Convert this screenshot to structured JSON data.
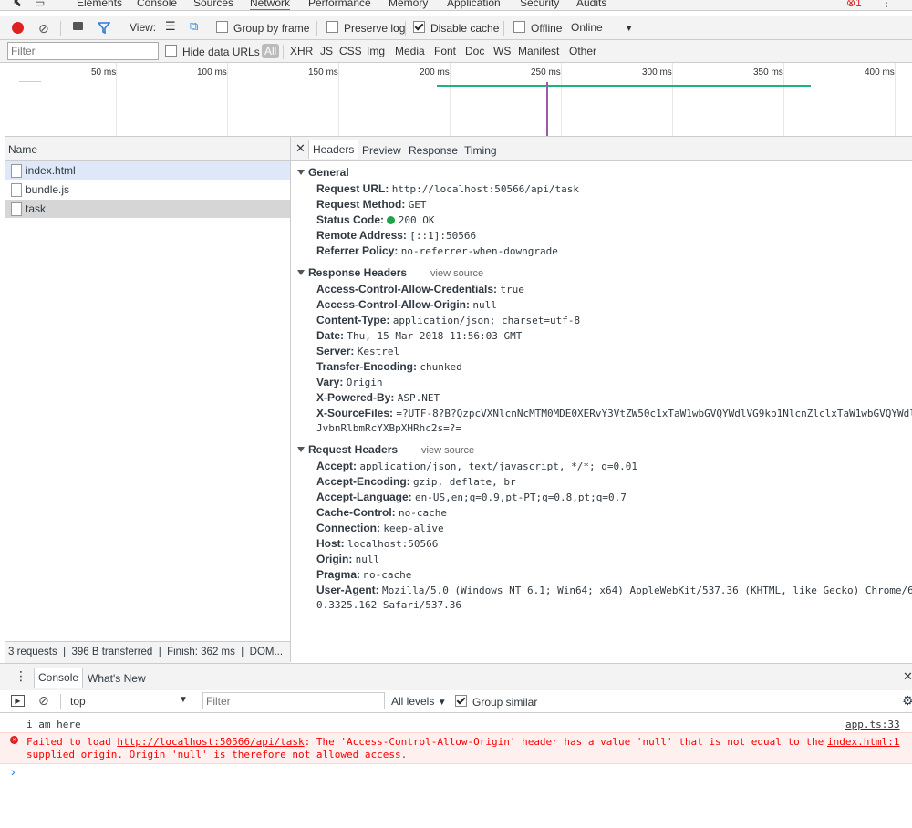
{
  "top_tabs": [
    "Elements",
    "Console",
    "Sources",
    "Network",
    "Performance",
    "Memory",
    "Application",
    "Security",
    "Audits"
  ],
  "active_tab": "Network",
  "error_count": "1",
  "toolbar": {
    "view_label": "View:",
    "group_by_frame": "Group by frame",
    "preserve_log": "Preserve log",
    "disable_cache": "Disable cache",
    "offline": "Offline",
    "online": "Online"
  },
  "filterbar": {
    "filter_placeholder": "Filter",
    "hide_data_urls": "Hide data URLs",
    "types": [
      "All",
      "XHR",
      "JS",
      "CSS",
      "Img",
      "Media",
      "Font",
      "Doc",
      "WS",
      "Manifest",
      "Other"
    ]
  },
  "timeline": {
    "ticks": [
      "50 ms",
      "100 ms",
      "150 ms",
      "200 ms",
      "250 ms",
      "300 ms",
      "350 ms",
      "400 ms"
    ]
  },
  "requests": {
    "header": "Name",
    "items": [
      "index.html",
      "bundle.js",
      "task"
    ],
    "status": "3 requests  |  396 B transferred  |  Finish: 362 ms  |  DOM..."
  },
  "detail_tabs": [
    "Headers",
    "Preview",
    "Response",
    "Timing"
  ],
  "general": {
    "title": "General",
    "items": [
      {
        "k": "Request URL:",
        "v": "http://localhost:50566/api/task"
      },
      {
        "k": "Request Method:",
        "v": "GET"
      },
      {
        "k": "Status Code:",
        "v": "200 OK"
      },
      {
        "k": "Remote Address:",
        "v": "[::1]:50566"
      },
      {
        "k": "Referrer Policy:",
        "v": "no-referrer-when-downgrade"
      }
    ]
  },
  "response_headers": {
    "title": "Response Headers",
    "view_source": "view source",
    "items": [
      {
        "k": "Access-Control-Allow-Credentials:",
        "v": "true"
      },
      {
        "k": "Access-Control-Allow-Origin:",
        "v": "null"
      },
      {
        "k": "Content-Type:",
        "v": "application/json; charset=utf-8"
      },
      {
        "k": "Date:",
        "v": "Thu, 15 Mar 2018 11:56:03 GMT"
      },
      {
        "k": "Server:",
        "v": "Kestrel"
      },
      {
        "k": "Transfer-Encoding:",
        "v": "chunked"
      },
      {
        "k": "Vary:",
        "v": "Origin"
      },
      {
        "k": "X-Powered-By:",
        "v": "ASP.NET"
      },
      {
        "k": "X-SourceFiles:",
        "v": "=?UTF-8?B?QzpcVXNlcnNcMTM0MDE0XERvY3VtZW50c1xTaW1wbGVQYWdlVG9kb1NlcnZlclxTaW1wbGVQYWdl"
      }
    ],
    "continuation": "JvbnRlbmRcYXBpXHRhc2s=?="
  },
  "request_headers": {
    "title": "Request Headers",
    "view_source": "view source",
    "items": [
      {
        "k": "Accept:",
        "v": "application/json, text/javascript, */*; q=0.01"
      },
      {
        "k": "Accept-Encoding:",
        "v": "gzip, deflate, br"
      },
      {
        "k": "Accept-Language:",
        "v": "en-US,en;q=0.9,pt-PT;q=0.8,pt;q=0.7"
      },
      {
        "k": "Cache-Control:",
        "v": "no-cache"
      },
      {
        "k": "Connection:",
        "v": "keep-alive"
      },
      {
        "k": "Host:",
        "v": "localhost:50566"
      },
      {
        "k": "Origin:",
        "v": "null"
      },
      {
        "k": "Pragma:",
        "v": "no-cache"
      },
      {
        "k": "User-Agent:",
        "v": "Mozilla/5.0 (Windows NT 6.1; Win64; x64) AppleWebKit/537.36 (KHTML, like Gecko) Chrome/6"
      }
    ],
    "continuation": "0.3325.162 Safari/537.36"
  },
  "drawer": {
    "tabs": [
      "Console",
      "What's New"
    ],
    "context": "top",
    "filter_placeholder": "Filter",
    "levels": "All levels",
    "group_similar": "Group similar"
  },
  "console": {
    "log_text": "i am here",
    "log_source": "app.ts:33",
    "error_prefix": "Failed to load ",
    "error_url": "http://localhost:50566/api/task",
    "error_rest": ": The 'Access-Control-Allow-Origin' header has a value 'null' that is not equal to the",
    "error_source": "index.html:1",
    "error_line2": "supplied origin. Origin 'null' is therefore not allowed access.",
    "prompt": "›"
  }
}
